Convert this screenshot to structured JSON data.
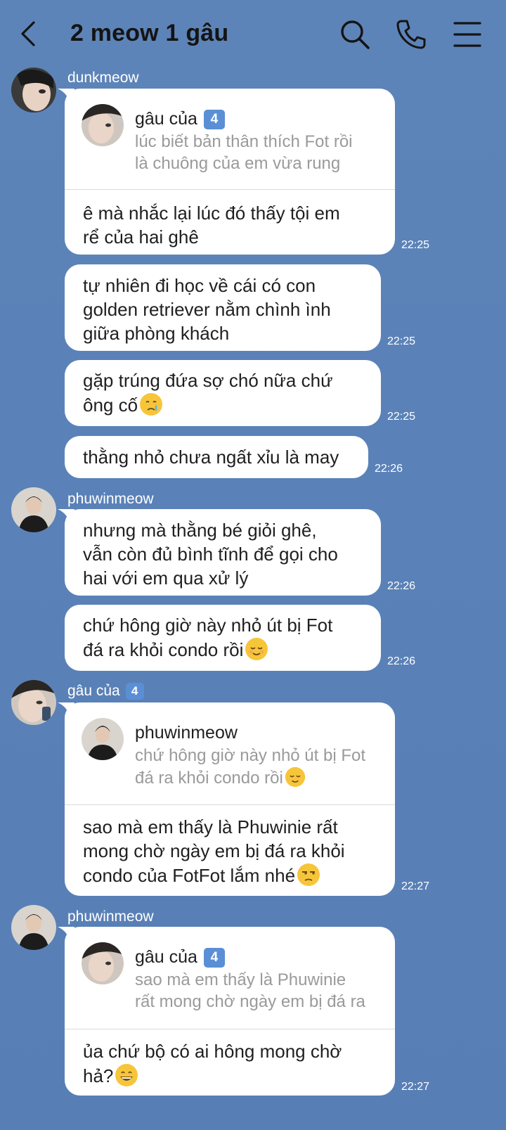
{
  "header": {
    "title": "2 meow 1 gâu",
    "icons": [
      "back-icon",
      "search-icon",
      "phone-icon",
      "menu-icon"
    ]
  },
  "colors": {
    "background": "#5a82b8",
    "bubble": "#ffffff",
    "badge": "#5a8fd6",
    "quote_text": "#9a9a9a"
  },
  "messages": {
    "m1": {
      "sender": "dunkmeow",
      "quote_name": "gâu của",
      "quote_badge": "4",
      "quote_text": "lúc biết bản thân thích Fot rồi\nlà chuông của em vừa rung",
      "text": "ê mà nhắc lại lúc đó thấy tội em\nrể của hai ghê",
      "time": "22:25"
    },
    "m2": {
      "text": "tự nhiên đi học về cái có con\ngolden retriever nằm chình ình\ngiữa phòng khách",
      "time": "22:25"
    },
    "m3": {
      "text": "gặp trúng đứa sợ chó nữa chứ\nông cố",
      "emoji": "crying-face-emoji",
      "time": "22:25"
    },
    "m4": {
      "text": "thằng nhỏ chưa ngất xỉu là may",
      "time": "22:26"
    },
    "m5": {
      "sender": "phuwinmeow",
      "text": "nhưng mà thằng bé giỏi ghê,\nvẫn còn đủ bình tĩnh để gọi cho\nhai với em qua xử lý",
      "time": "22:26"
    },
    "m6": {
      "text": "chứ hông giờ này nhỏ út bị Fot\nđá ra khỏi condo rồi",
      "emoji": "relieved-face-emoji",
      "time": "22:26"
    },
    "m7": {
      "sender": "gâu của",
      "sender_badge": "4",
      "quote_name": "phuwinmeow",
      "quote_text": "chứ hông giờ này nhỏ út bị Fot\nđá ra khỏi condo rồi",
      "text": "sao mà em thấy là Phuwinie rất\nmong chờ ngày em bị đá ra khỏi\ncondo của FotFot lắm nhé",
      "emoji": "unamused-face-emoji",
      "time": "22:27"
    },
    "m8": {
      "sender": "phuwinmeow",
      "quote_name": "gâu của",
      "quote_badge": "4",
      "quote_text": "sao mà em thấy là Phuwinie\nrất mong chờ ngày em bị đá ra",
      "text": "ủa chứ bộ có ai hông mong chờ\nhả?",
      "emoji": "grinning-face-emoji",
      "time": "22:27"
    }
  }
}
